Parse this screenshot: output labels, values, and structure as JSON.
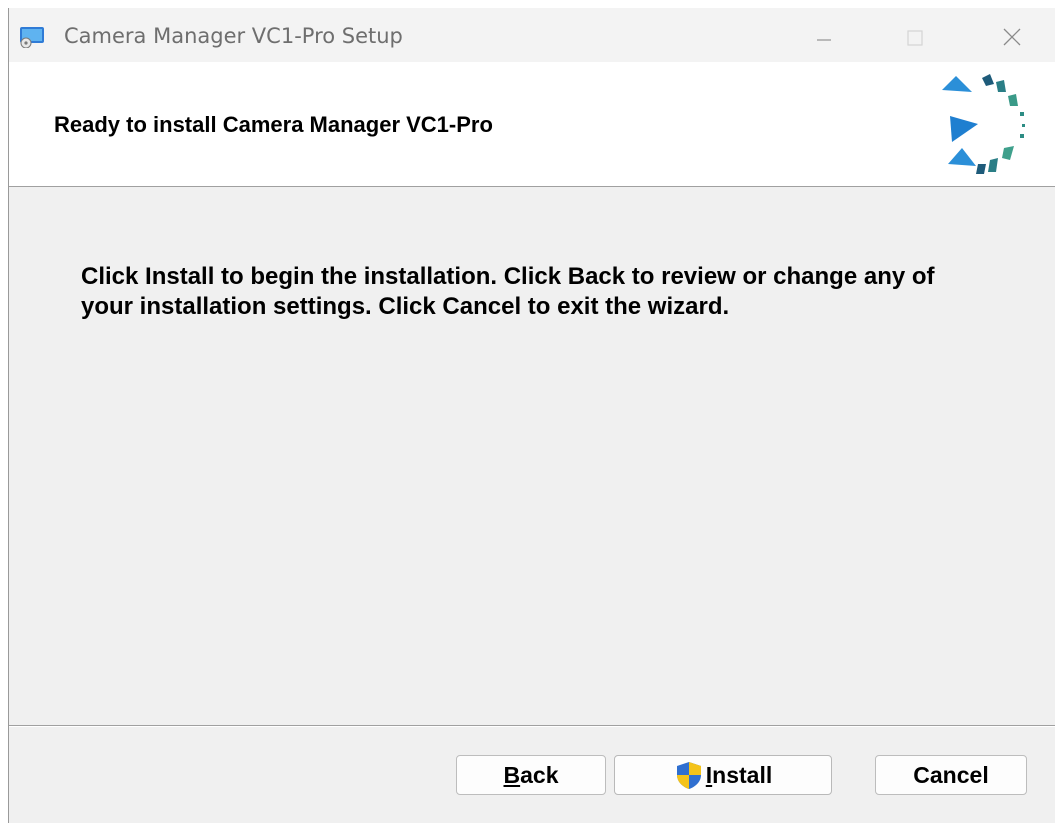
{
  "window": {
    "title": "Camera Manager VC1-Pro Setup",
    "controls": [
      "minimize",
      "maximize",
      "close"
    ]
  },
  "header": {
    "title": "Ready to install Camera Manager VC1-Pro",
    "logo_icon": "installer-logo-icon"
  },
  "content": {
    "message": "Click Install to begin the installation. Click Back to review or change any of your installation settings. Click Cancel to exit the wizard."
  },
  "buttons": {
    "back": {
      "mnemonic": "B",
      "rest": "ack"
    },
    "install": {
      "mnemonic": "I",
      "rest": "nstall",
      "icon": "uac-shield-icon"
    },
    "cancel": {
      "label": "Cancel"
    }
  },
  "colors": {
    "accent": "#2f7bd6",
    "dialog_bg": "#f0f0f0",
    "header_bg": "#ffffff"
  }
}
